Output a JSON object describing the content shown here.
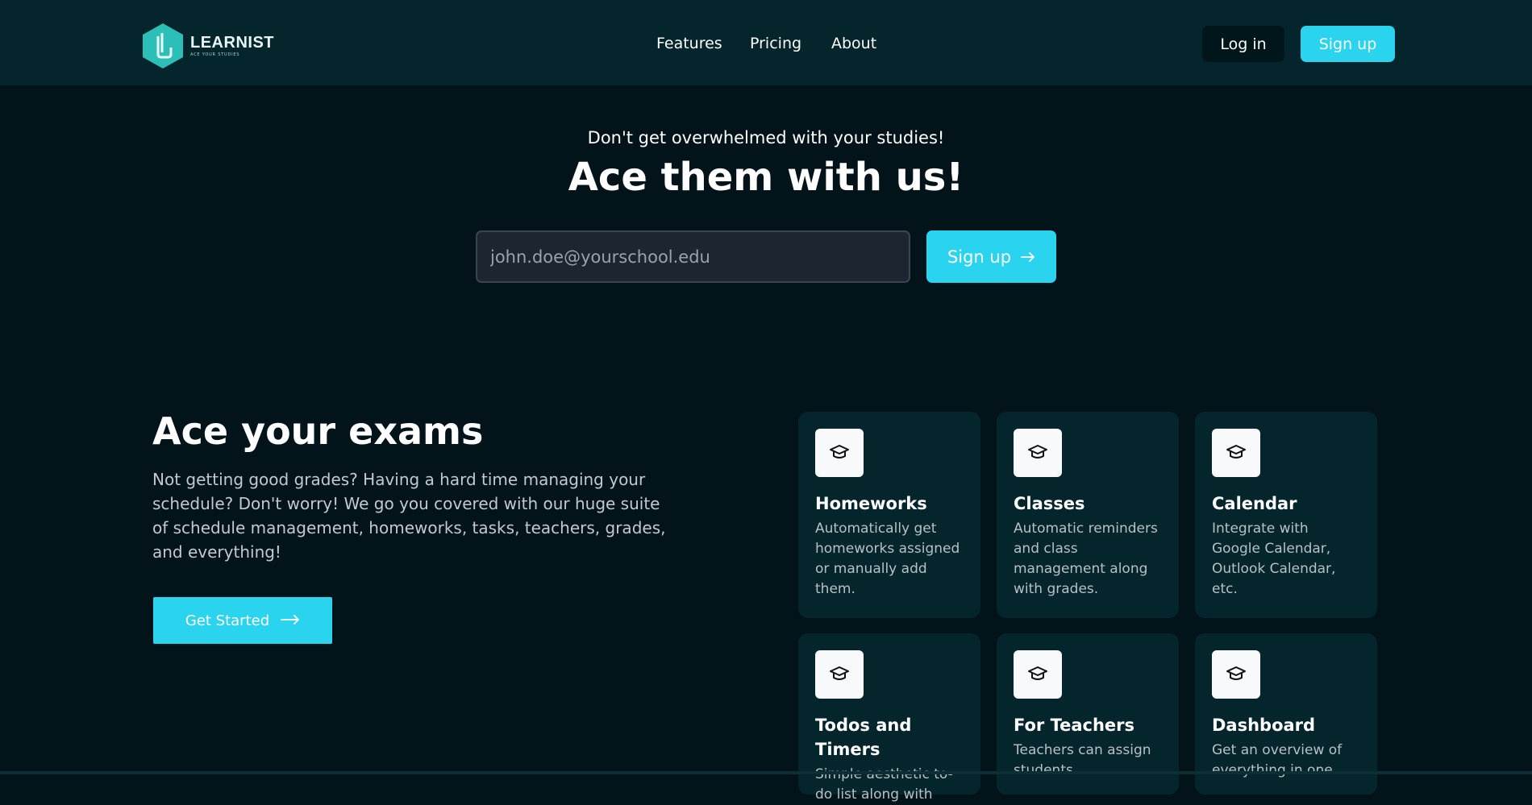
{
  "header": {
    "logo_name": "LEARNIST",
    "logo_tagline": "ACE YOUR STUDIES",
    "nav": [
      "Features",
      "Pricing",
      "About"
    ],
    "login_label": "Log in",
    "signup_label": "Sign up"
  },
  "hero": {
    "subtitle": "Don't get overwhelmed with your studies!",
    "title": "Ace them with us!",
    "email_placeholder": "john.doe@yourschool.edu",
    "signup_label": "Sign up"
  },
  "section": {
    "title": "Ace your exams",
    "body": "Not getting good grades? Having a hard time managing your schedule? Don't worry! We go you covered with our huge suite of schedule management, homeworks, tasks, teachers, grades, and everything!",
    "cta_label": "Get Started"
  },
  "features": [
    {
      "title": "Homeworks",
      "desc": "Automatically get homeworks assigned or manually add them.",
      "icon": "graduation-cap-icon"
    },
    {
      "title": "Classes",
      "desc": "Automatic reminders and class management along with grades.",
      "icon": "graduation-cap-icon"
    },
    {
      "title": "Calendar",
      "desc": "Integrate with Google Calendar, Outlook Calendar, etc.",
      "icon": "graduation-cap-icon"
    },
    {
      "title": "Todos and Timers",
      "desc": "Simple aesthetic to-do list along with",
      "icon": "graduation-cap-icon"
    },
    {
      "title": "For Teachers",
      "desc": "Teachers can assign students",
      "icon": "graduation-cap-icon"
    },
    {
      "title": "Dashboard",
      "desc": "Get an overview of everything in one",
      "icon": "graduation-cap-icon"
    }
  ],
  "colors": {
    "background": "#02141a",
    "header": "#03252b",
    "accent": "#2ad4ee",
    "card": "#03252b",
    "logo": "#2bbfb8"
  }
}
